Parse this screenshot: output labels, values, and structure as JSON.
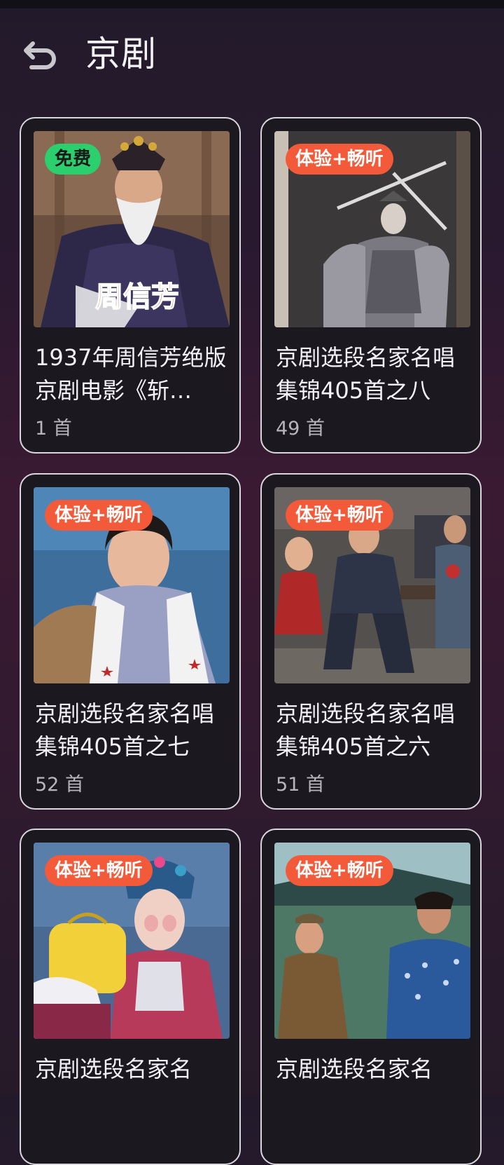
{
  "header": {
    "back_icon": "back-arrow-icon",
    "title": "京剧"
  },
  "albums": [
    {
      "badge": "免费",
      "badge_type": "free",
      "title": "1937年周信芳绝版京剧电影《斩…",
      "count": "1 首",
      "cover_caption": "周信芳"
    },
    {
      "badge": "体验+畅听",
      "badge_type": "trial",
      "title": "京剧选段名家名唱集锦405首之八",
      "count": "49 首"
    },
    {
      "badge": "体验+畅听",
      "badge_type": "trial",
      "title": "京剧选段名家名唱集锦405首之七",
      "count": "52 首"
    },
    {
      "badge": "体验+畅听",
      "badge_type": "trial",
      "title": "京剧选段名家名唱集锦405首之六",
      "count": "51 首"
    },
    {
      "badge": "体验+畅听",
      "badge_type": "trial",
      "title": "京剧选段名家名",
      "count": ""
    },
    {
      "badge": "体验+畅听",
      "badge_type": "trial",
      "title": "京剧选段名家名",
      "count": ""
    }
  ],
  "colors": {
    "free_badge": "#2ccf6e",
    "trial_badge": "#f25a3a",
    "card_border": "#d9d6dc"
  }
}
